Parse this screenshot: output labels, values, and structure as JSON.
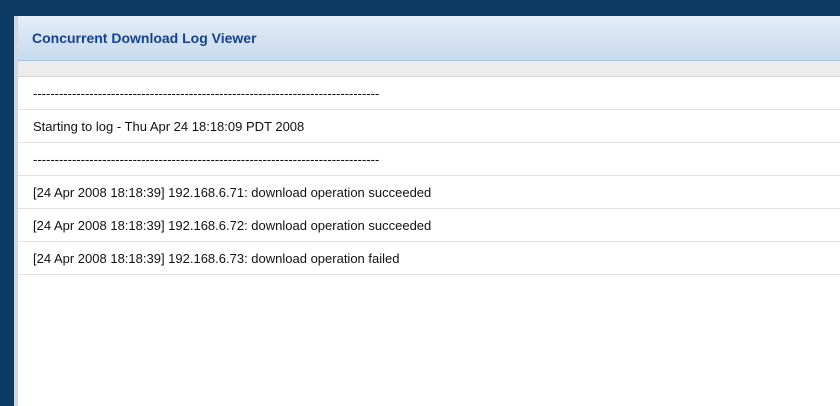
{
  "window": {
    "title": "Concurrent Download Log Viewer"
  },
  "log": {
    "lines": [
      "--------------------------------------------------------------------------------",
      "Starting to log - Thu Apr 24 18:18:09 PDT 2008",
      "--------------------------------------------------------------------------------",
      "[24 Apr 2008 18:18:39] 192.168.6.71: download operation succeeded",
      "[24 Apr 2008 18:18:39] 192.168.6.72: download operation succeeded",
      "[24 Apr 2008 18:18:39] 192.168.6.73: download operation failed"
    ]
  },
  "colors": {
    "title_text": "#15428b",
    "frame_border": "#0e3a66"
  }
}
